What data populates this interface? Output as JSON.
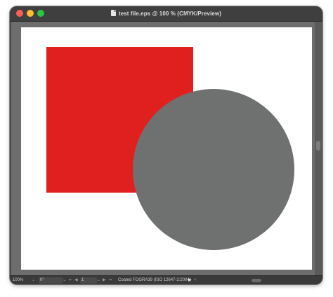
{
  "window": {
    "title": "test file.eps @ 100 % (CMYK/Preview)"
  },
  "artwork": {
    "shapes": [
      {
        "kind": "rectangle",
        "fill": "#e0201e"
      },
      {
        "kind": "circle",
        "fill": "#6f7070"
      }
    ]
  },
  "status": {
    "zoom": "100%",
    "rotation": "0°",
    "page": "1",
    "profile": "Coated FOGRA39 (ISO 12647-2:2004)"
  },
  "colors": {
    "chrome": "#3f3f3f",
    "pasteboard": "#6d6d6d",
    "artboard": "#ffffff"
  }
}
